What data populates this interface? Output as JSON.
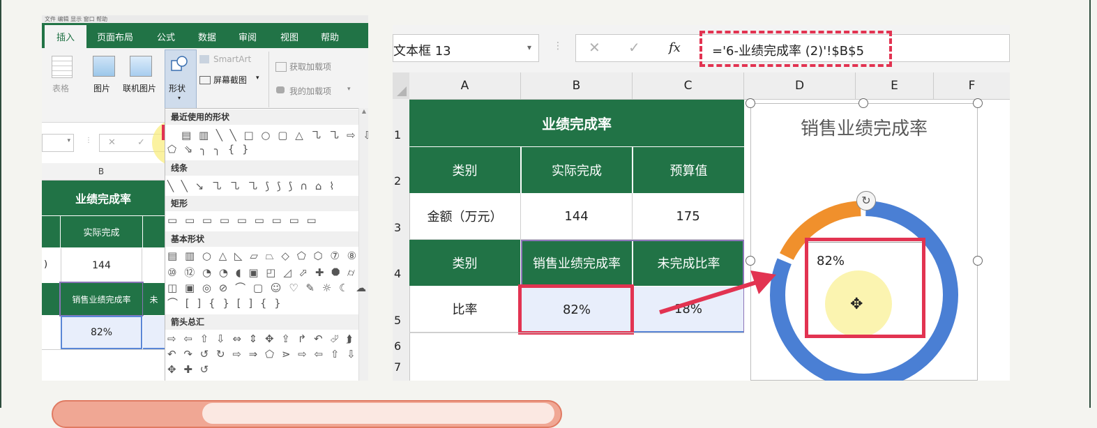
{
  "left": {
    "top_menu": "文件  编辑  显示  窗口  帮助",
    "tabs": [
      "插入",
      "页面布局",
      "公式",
      "数据",
      "审阅",
      "视图",
      "帮助"
    ],
    "active_tab": "插入",
    "ribbon": {
      "table": "表格",
      "picture": "图片",
      "online_picture": "联机图片",
      "shapes": "形状",
      "smartart": "SmartArt",
      "screenshot": "屏幕截图",
      "get_addins": "获取加载项",
      "my_addins": "我的加载项"
    },
    "dropdown": {
      "recent": "最近使用的形状",
      "lines": "线条",
      "rect": "矩形",
      "basic": "基本形状",
      "arrows": "箭头总汇",
      "glyphs_recent_1": "▤ ▥ ╲ ╲ □ ○ ▢ △ ㇈ ㇈ ⇨ ⇩",
      "glyphs_recent_2": "⬠ ⇘ ╮ ╮ { }",
      "glyphs_lines": "╲ ╲ ↘ ㇈ ㇈ ㇈ ⟆ ⟆ ⟆ ∩ ⌂ ⌇",
      "glyphs_rect": "▭ ▭ ▭ ▭ ▭ ▭ ▭ ▭ ▭",
      "glyphs_basic_1": "▤ ▥ ○ △ ◺ ▱ ⏢ ◇ ⬠ ⬡ ⑦ ⑧",
      "glyphs_basic_2": "⑩ ⑫ ◔ ◔ ◖ ▣ ◰ ◿ ⬀ ✚ ⯃ ⌭",
      "glyphs_basic_3": "◫ ▣ ◎ ⊘ ⌒ ▢ ☺ ♡ ✎ ☼ ☾ ☁",
      "glyphs_basic_4": "⌒ [ ] { } [ ] { }",
      "glyphs_arrows_1": "⇨ ⇦ ⇧ ⇩ ⇔ ⇕ ✥ ⇪ ↱ ↶ ⮰ ⮭",
      "glyphs_arrows_2": "↶ ↷ ↺ ↻ ⇨ ⇒ ⬠ ⋗ ⇨ ⇦ ⇧ ⇩",
      "glyphs_arrows_3": "✥ ✚ ↺"
    },
    "col_b": "B",
    "cells": {
      "title": "业绩完成率",
      "actual": "实际完成",
      "value": "144",
      "row4_label": "销售业绩完成率",
      "row4_next": "未",
      "pct": "82%",
      "stub": ")"
    }
  },
  "right": {
    "namebox": "文本框 13",
    "fx": "fx",
    "formula": "='6-业绩完成率 (2)'!$B$5",
    "columns": [
      "A",
      "B",
      "C",
      "D",
      "E",
      "F"
    ],
    "rows": [
      "1",
      "2",
      "3",
      "4",
      "5",
      "6",
      "7"
    ],
    "table": {
      "title": "业绩完成率",
      "r2": [
        "类别",
        "实际完成",
        "预算值"
      ],
      "r3": [
        "金额（万元）",
        "144",
        "175"
      ],
      "r4": [
        "类别",
        "销售业绩完成率",
        "未完成比率"
      ],
      "r5": [
        "比率",
        "82%",
        "18%"
      ]
    },
    "chart": {
      "title": "销售业绩完成率",
      "label": "82%"
    }
  },
  "chart_data": {
    "type": "pie",
    "title": "销售业绩完成率",
    "categories": [
      "销售业绩完成率",
      "未完成比率"
    ],
    "values": [
      82,
      18
    ],
    "colors": [
      "#4a7fd4",
      "#f0902c"
    ],
    "style": "doughnut"
  }
}
